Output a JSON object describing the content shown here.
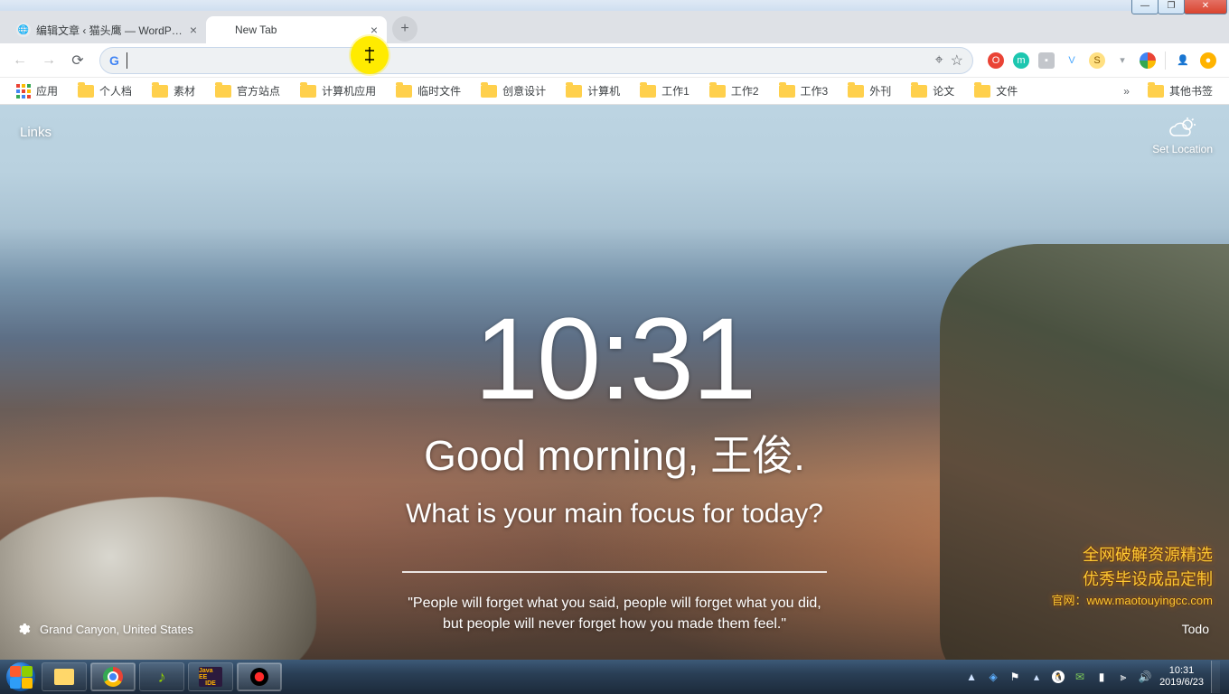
{
  "window_controls": {
    "min": "—",
    "max": "❐",
    "close": "✕"
  },
  "tabs": [
    {
      "favicon_color": "#9aa0a6",
      "favicon_glyph": "🌐",
      "title": "编辑文章 ‹ 猫头鹰 — WordPres",
      "active": false
    },
    {
      "favicon_color": "transparent",
      "favicon_glyph": "",
      "title": "New Tab",
      "active": true
    }
  ],
  "newtab_plus": "+",
  "toolbar": {
    "back": "←",
    "forward": "→",
    "reload": "⟳",
    "location_target": "⌖",
    "star": "☆",
    "address_value": ""
  },
  "extensions": [
    {
      "bg": "#ea4335",
      "glyph": "O",
      "fg": "#fff"
    },
    {
      "bg": "#1dc7b0",
      "glyph": "m",
      "fg": "#fff"
    },
    {
      "bg": "#9aa0a6",
      "glyph": "▪",
      "fg": "#fff"
    },
    {
      "bg": "#4aa8ff",
      "glyph": "V",
      "fg": "#fff"
    },
    {
      "bg": "#ffd54f",
      "glyph": "S",
      "fg": "#8a5a00"
    },
    {
      "bg": "#9aa0a6",
      "glyph": "▾",
      "fg": "#fff"
    },
    {
      "bg": "#ffffff",
      "glyph": "◯",
      "fg": "#ea4335"
    },
    {
      "bg": "",
      "glyph": "",
      "fg": ""
    },
    {
      "bg": "#ffffff",
      "glyph": "👤",
      "fg": ""
    },
    {
      "bg": "#ffb300",
      "glyph": "●",
      "fg": "#fff"
    }
  ],
  "bookmarks": {
    "apps": "应用",
    "folders": [
      "个人档",
      "素材",
      "官方站点",
      "计算机应用",
      "临时文件",
      "创意设计",
      "计算机",
      "工作1",
      "工作2",
      "工作3",
      "外刊",
      "论文",
      "文件"
    ],
    "overflow_glyph": "»",
    "other": "其他书签"
  },
  "momentum": {
    "links": "Links",
    "set_location": "Set Location",
    "time": "10:31",
    "greeting": "Good morning, 王俊.",
    "focus_question": "What is your main focus for today?",
    "quote_l1": "\"People will forget what you said, people will forget what you did,",
    "quote_l2": "but people will never forget how you made them feel.\"",
    "photo_location": "Grand Canyon, United States",
    "todo": "Todo",
    "watermark_l1": "全网破解资源精选",
    "watermark_l2": "优秀毕设成品定制",
    "watermark_l3": "官网：www.maotouyingcc.com"
  },
  "taskbar": {
    "tray_arrow": "▲",
    "flag": "⚑",
    "clock_time": "10:31",
    "clock_date": "2019/6/23"
  }
}
